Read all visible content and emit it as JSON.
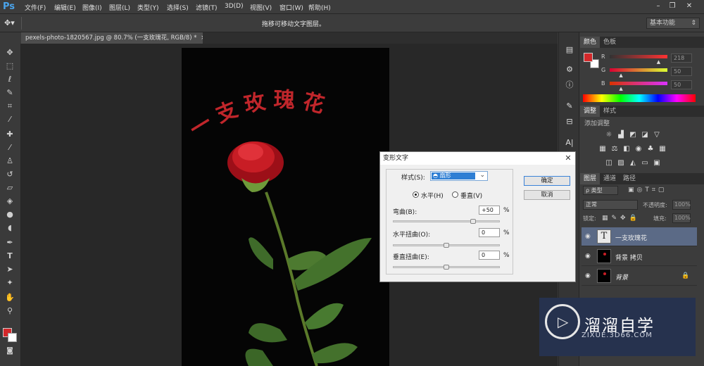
{
  "menubar": {
    "logo": "Ps",
    "items": [
      "文件(F)",
      "编辑(E)",
      "图像(I)",
      "图层(L)",
      "类型(Y)",
      "选择(S)",
      "滤镜(T)",
      "3D(D)",
      "视图(V)",
      "窗口(W)",
      "帮助(H)"
    ]
  },
  "optionsbar": {
    "hint": "拖移可移动文字图层。",
    "workspace": "基本功能"
  },
  "document": {
    "tab_title": "pexels-photo-1820567.jpg @ 80.7% (一支玫瑰花, RGB/8) *",
    "close": "×",
    "warped_text": "一支玫瑰花",
    "text_color": "#c0262b"
  },
  "color_panel": {
    "tabs": [
      "颜色",
      "色板"
    ],
    "fg_color": "#d4282a",
    "channels": [
      {
        "label": "R",
        "value": "218",
        "fraction": 0.85
      },
      {
        "label": "G",
        "value": "50",
        "fraction": 0.2
      },
      {
        "label": "B",
        "value": "50",
        "fraction": 0.2
      }
    ]
  },
  "adjust_panel": {
    "tabs": [
      "调整",
      "样式"
    ],
    "add_label": "添加调整"
  },
  "layers_panel": {
    "tabs": [
      "图层",
      "通道",
      "路径"
    ],
    "kind_filter": "ρ 类型",
    "blend_mode": "正常",
    "opacity_label": "不透明度:",
    "opacity_value": "100%",
    "lock_label": "锁定:",
    "fill_label": "填充:",
    "fill_value": "100%",
    "layers": [
      {
        "name": "一支玫瑰花",
        "type": "text",
        "selected": true
      },
      {
        "name": "背景 拷贝",
        "type": "image",
        "selected": false
      },
      {
        "name": "背景",
        "type": "image",
        "selected": false,
        "locked": true
      }
    ]
  },
  "dialog": {
    "title": "变形文字",
    "close": "✕",
    "style_label": "样式(S):",
    "style_value": "扇形",
    "horizontal_label": "水平(H)",
    "vertical_label": "垂直(V)",
    "orientation": "horizontal",
    "bend_label": "弯曲(B):",
    "bend_value": "+50",
    "bend_fraction": 0.75,
    "hdistort_label": "水平扭曲(O):",
    "hdistort_value": "0",
    "vdistort_label": "垂直扭曲(E):",
    "vdistort_value": "0",
    "percent": "%",
    "ok_label": "确定",
    "cancel_label": "取消"
  },
  "watermark": {
    "title": "溜溜自学",
    "url": "ZIXUE.3D66.COM"
  }
}
